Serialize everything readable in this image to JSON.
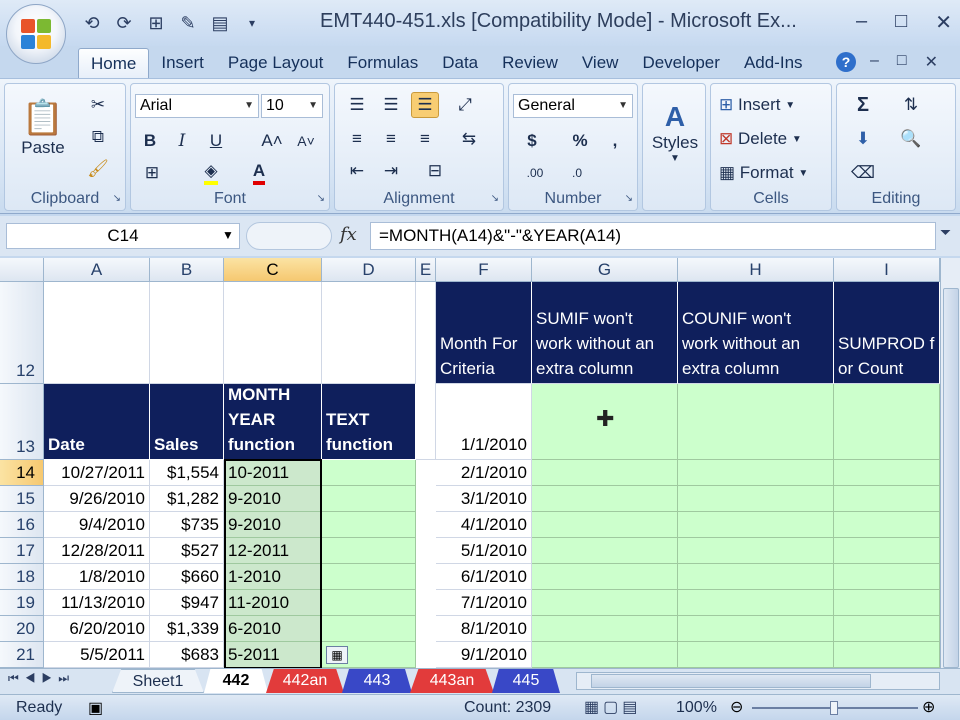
{
  "window": {
    "title": "EMT440-451.xls  [Compatibility Mode] - Microsoft Ex...",
    "controls": [
      "–",
      "□",
      "✕"
    ],
    "doc_controls": [
      "–",
      "□",
      "✕"
    ]
  },
  "tabs": [
    "Home",
    "Insert",
    "Page Layout",
    "Formulas",
    "Data",
    "Review",
    "View",
    "Developer",
    "Add-Ins"
  ],
  "ribbon": {
    "clipboard": {
      "label": "Clipboard",
      "paste": "Paste"
    },
    "font": {
      "label": "Font",
      "name": "Arial",
      "size": "10",
      "bold": "B",
      "italic": "I",
      "underline": "U",
      "grow": "A˄",
      "shrink": "A˅"
    },
    "alignment": {
      "label": "Alignment"
    },
    "number": {
      "label": "Number",
      "format": "General",
      "currency": "$",
      "percent": "%",
      "comma": ",",
      "inc_dec": ".00",
      "dec_dec": ".0"
    },
    "styles": {
      "label": "Styles"
    },
    "cells": {
      "label": "Cells",
      "insert": "Insert",
      "delete": "Delete",
      "format": "Format"
    },
    "editing": {
      "label": "Editing",
      "sum": "Σ"
    }
  },
  "formula_bar": {
    "name_box": "C14",
    "fx": "fx",
    "formula": "=MONTH(A14)&\"-\"&YEAR(A14)"
  },
  "columns": [
    "A",
    "B",
    "C",
    "D",
    "E",
    "F",
    "G",
    "H",
    "I"
  ],
  "rows": [
    "12",
    "13",
    "14",
    "15",
    "16",
    "17",
    "18",
    "19",
    "20",
    "21"
  ],
  "headers": {
    "date": "Date",
    "sales": "Sales",
    "month_year": "MONTH YEAR function",
    "text_fn": "TEXT function",
    "month_criteria": "Month For Criteria",
    "sumif": "SUMIF won't work without an extra column",
    "countif": "COUNIF won't work without an extra column",
    "sumprod": "SUMPROD for Count"
  },
  "data_rows": [
    {
      "date": "10/27/2011",
      "sales": "$1,554",
      "my": "10-2011"
    },
    {
      "date": "9/26/2010",
      "sales": "$1,282",
      "my": "9-2010"
    },
    {
      "date": "9/4/2010",
      "sales": "$735",
      "my": "9-2010"
    },
    {
      "date": "12/28/2011",
      "sales": "$527",
      "my": "12-2011"
    },
    {
      "date": "1/8/2010",
      "sales": "$660",
      "my": "1-2010"
    },
    {
      "date": "11/13/2010",
      "sales": "$947",
      "my": "11-2010"
    },
    {
      "date": "6/20/2010",
      "sales": "$1,339",
      "my": "6-2010"
    },
    {
      "date": "5/5/2011",
      "sales": "$683",
      "my": "5-2011"
    }
  ],
  "criteria_dates": [
    "1/1/2010",
    "2/1/2010",
    "3/1/2010",
    "4/1/2010",
    "5/1/2010",
    "6/1/2010",
    "7/1/2010",
    "8/1/2010",
    "9/1/2010"
  ],
  "sheet_tabs": [
    "Sheet1",
    "442",
    "442an",
    "443",
    "443an",
    "445"
  ],
  "status": {
    "ready": "Ready",
    "count": "Count: 2309",
    "zoom": "100%"
  }
}
